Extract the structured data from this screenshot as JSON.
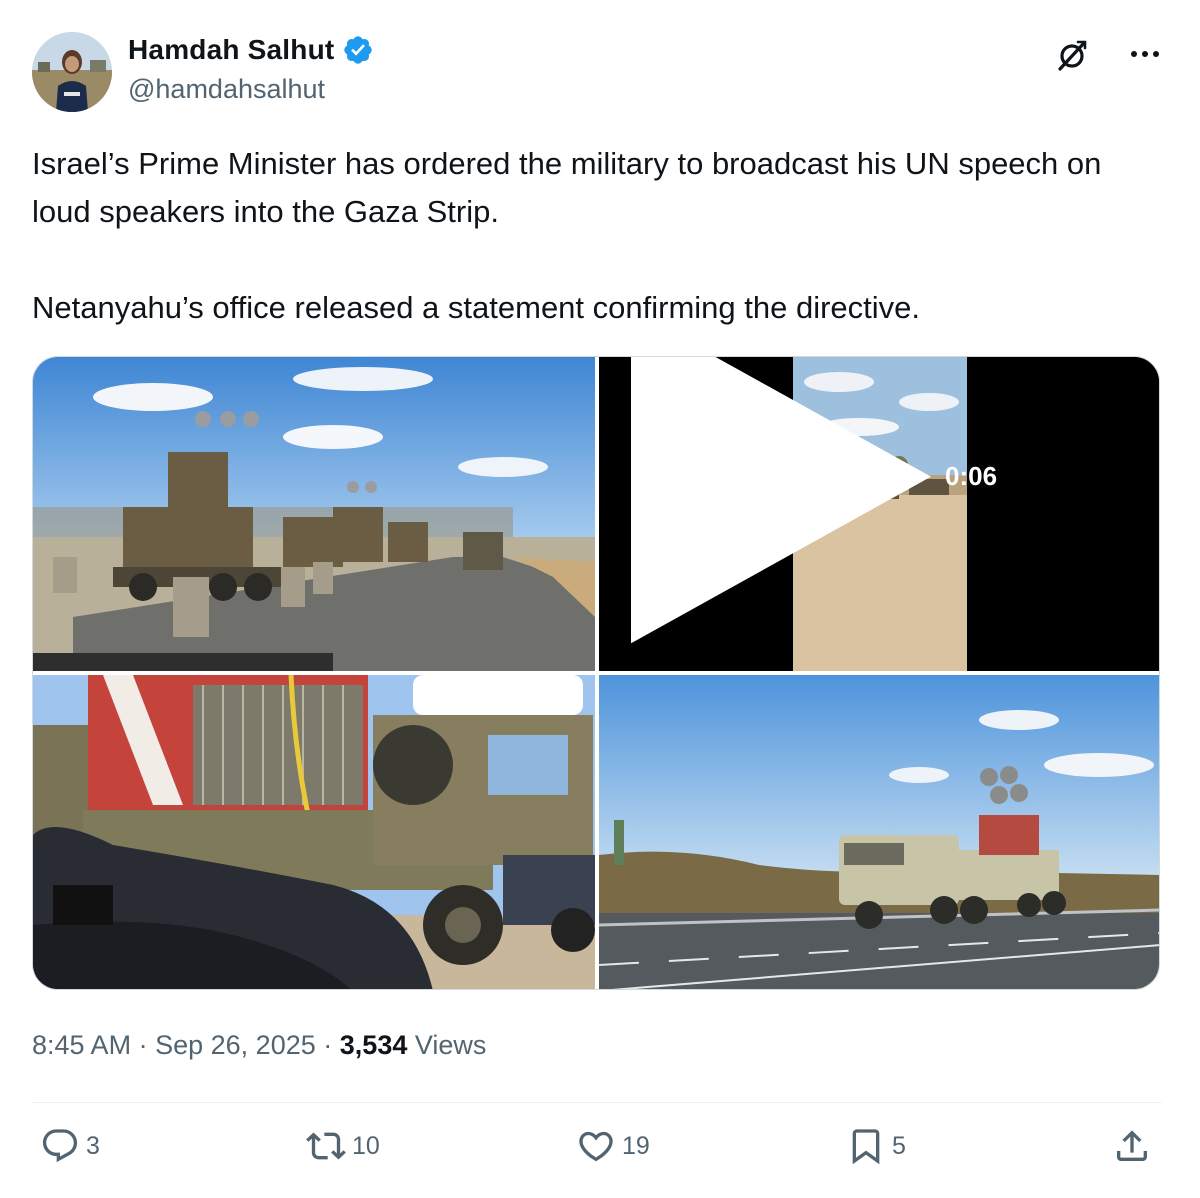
{
  "author": {
    "display_name": "Hamdah Salhut",
    "handle": "@hamdahsalhut",
    "verified": true
  },
  "icons": {
    "verified": "verified-badge-icon",
    "grok": "grok-icon",
    "more": "more-options-icon",
    "play": "play-icon",
    "reply": "reply-icon",
    "repost": "repost-icon",
    "like": "heart-icon",
    "bookmark": "bookmark-icon",
    "share": "share-icon"
  },
  "tweet": {
    "paragraph1": "Israel’s Prime Minister has ordered the military to broadcast his UN speech on loud speakers into the Gaza Strip.",
    "paragraph2": "Netanyahu’s office released a statement confirming the directive."
  },
  "media": {
    "video_duration": "0:06"
  },
  "meta": {
    "time": "8:45 AM",
    "separator": "·",
    "date": "Sep 26, 2025",
    "views_count": "3,534",
    "views_label": "Views"
  },
  "actions": {
    "replies": "3",
    "reposts": "10",
    "likes": "19",
    "bookmarks": "5"
  },
  "colors": {
    "text_primary": "#0f1419",
    "text_secondary": "#536471",
    "verified_blue": "#1d9bf0",
    "border": "#cfd9de"
  }
}
